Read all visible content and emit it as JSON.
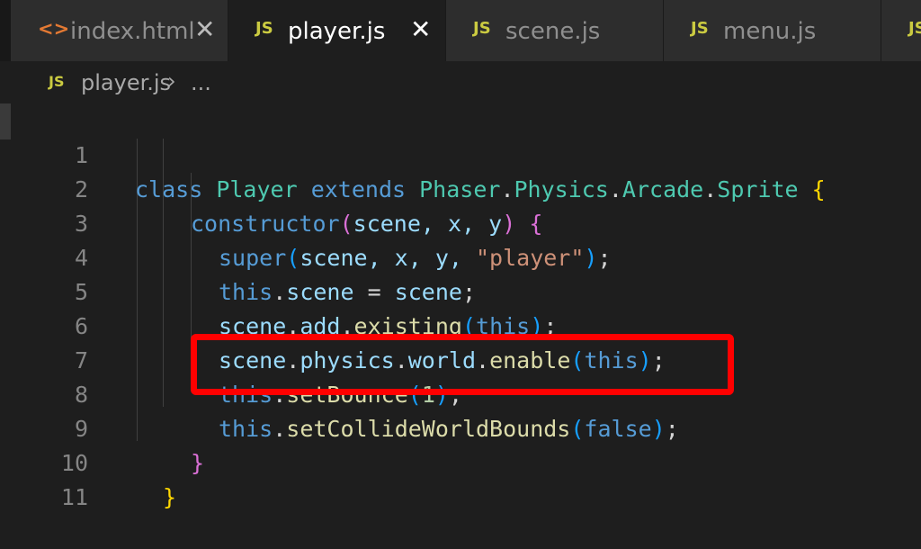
{
  "tabs": [
    {
      "icon": "<>",
      "label": "index.html",
      "close": "✕",
      "active": false
    },
    {
      "icon": "JS",
      "label": "player.js",
      "close": "✕",
      "active": true
    },
    {
      "icon": "JS",
      "label": "scene.js",
      "active": false
    },
    {
      "icon": "JS",
      "label": "menu.js",
      "active": false
    },
    {
      "icon": "JS",
      "active": false
    }
  ],
  "breadcrumb": {
    "icon": "JS",
    "file": "player.js",
    "separator": "›",
    "more": "..."
  },
  "line_numbers": [
    "1",
    "2",
    "3",
    "4",
    "5",
    "6",
    "7",
    "8",
    "9",
    "10",
    "11"
  ],
  "code": {
    "l1": {
      "class": "class",
      "name": "Player",
      "extends": "extends",
      "base1": "Phaser",
      "base2": "Physics",
      "base3": "Arcade",
      "base4": "Sprite",
      "brace": "{"
    },
    "l2": {
      "ctor": "constructor",
      "open": "(",
      "params": "scene, x, y",
      "close": ")",
      "brace": "{"
    },
    "l3": {
      "super": "super",
      "open": "(",
      "args": "scene, x, y, ",
      "str": "\"player\"",
      "close": ")",
      "end": ";"
    },
    "l4": {
      "this": "this",
      "prop": "scene",
      "eq": " = ",
      "val": "scene",
      "end": ";"
    },
    "l5": {
      "obj": "scene",
      "prop": "add",
      "fn": "existing",
      "open": "(",
      "arg": "this",
      "close": ")",
      "end": ";"
    },
    "l6": {
      "obj": "scene",
      "p1": "physics",
      "p2": "world",
      "fn": "enable",
      "open": "(",
      "arg": "this",
      "close": ")",
      "end": ";"
    },
    "l7": {
      "this": "this",
      "fn": "setBounce",
      "open": "(",
      "arg": "1",
      "close": ")",
      "end": ";"
    },
    "l8": {
      "this": "this",
      "fn": "setCollideWorldBounds",
      "open": "(",
      "arg": "false",
      "close": ")",
      "end": ";"
    },
    "l9": {
      "brace": "}"
    },
    "l10": {
      "brace": "}"
    }
  },
  "colors": {
    "highlight_border": "#ff0000",
    "editor_bg": "#1e1e1e"
  }
}
